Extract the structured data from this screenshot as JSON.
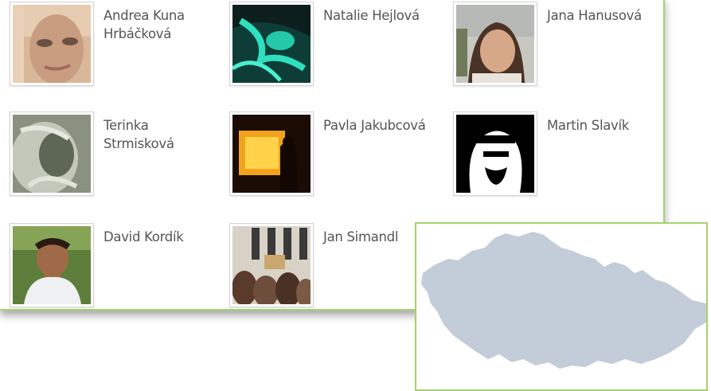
{
  "friends": [
    {
      "name": "Andrea Kuna Hrbáčková",
      "photo": "face-blonde"
    },
    {
      "name": "Natalie Hejlová",
      "photo": "face-teal"
    },
    {
      "name": "Jana Hanusová",
      "photo": "face-woman"
    },
    {
      "name": "Terinka Strmisková",
      "photo": "face-bw"
    },
    {
      "name": "Pavla Jakubcová",
      "photo": "silhouette-screen"
    },
    {
      "name": "Martin Slavík",
      "photo": "face-stencil"
    },
    {
      "name": "David Kordík",
      "photo": "face-man"
    },
    {
      "name": "Jan Simandl",
      "photo": "crowd"
    }
  ],
  "map": {
    "region": "czech-republic-map",
    "fill": "#c3ccd9"
  },
  "colors": {
    "accent_border": "#a7d06d",
    "name_text": "#555555"
  }
}
